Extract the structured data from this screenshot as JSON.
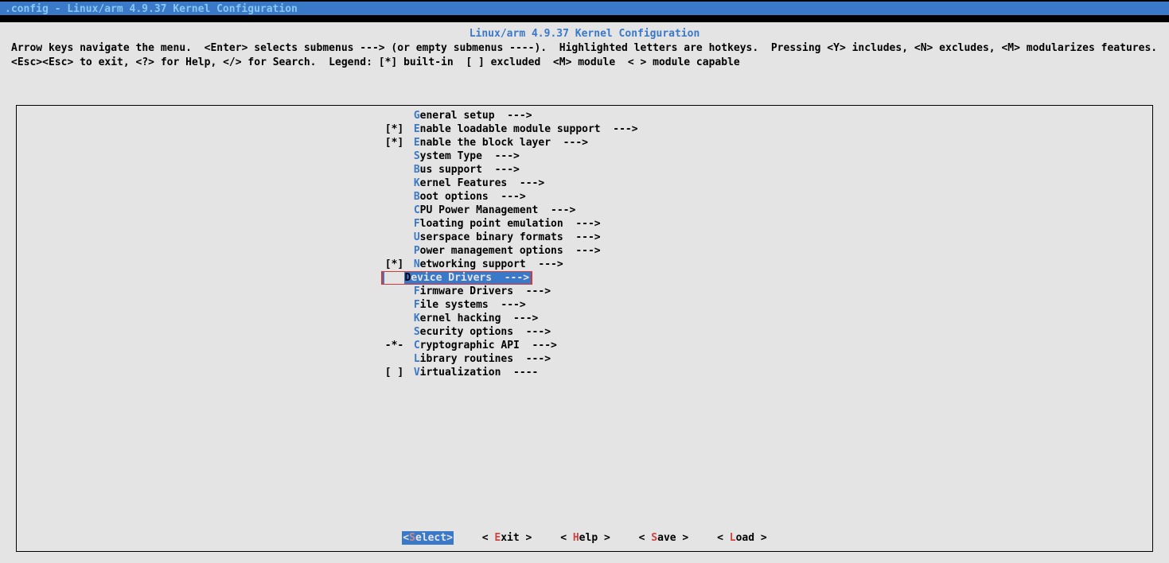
{
  "window_title": ".config - Linux/arm 4.9.37 Kernel Configuration",
  "header_title": "Linux/arm 4.9.37 Kernel Configuration",
  "instructions_line1": "Arrow keys navigate the menu.  <Enter> selects submenus ---> (or empty submenus ----).  Highlighted letters are hotkeys.  Pressing <Y> includes, <N> excludes, <M> modularizes features.  Press",
  "instructions_line2": "<Esc><Esc> to exit, <?> for Help, </> for Search.  Legend: [*] built-in  [ ] excluded  <M> module  < > module capable",
  "menu": [
    {
      "prefix": "   ",
      "hk": "G",
      "rest": "eneral setup  --->"
    },
    {
      "prefix": "[*]",
      "hk": "E",
      "rest": "nable loadable module support  --->"
    },
    {
      "prefix": "[*]",
      "hk": "E",
      "rest": "nable the block layer  --->"
    },
    {
      "prefix": "   ",
      "hk": "S",
      "rest": "ystem Type  --->"
    },
    {
      "prefix": "   ",
      "hk": "B",
      "rest": "us support  --->"
    },
    {
      "prefix": "   ",
      "hk": "K",
      "rest": "ernel Features  --->"
    },
    {
      "prefix": "   ",
      "hk": "B",
      "rest": "oot options  --->"
    },
    {
      "prefix": "   ",
      "hk": "C",
      "rest": "PU Power Management  --->"
    },
    {
      "prefix": "   ",
      "hk": "F",
      "rest": "loating point emulation  --->"
    },
    {
      "prefix": "   ",
      "hk": "U",
      "rest": "serspace binary formats  --->"
    },
    {
      "prefix": "   ",
      "hk": "P",
      "rest": "ower management options  --->"
    },
    {
      "prefix": "[*]",
      "hk": "N",
      "rest": "etworking support  --->"
    },
    {
      "prefix": "   ",
      "hk": "D",
      "rest": "evice Drivers  --->",
      "selected": true
    },
    {
      "prefix": "   ",
      "hk": "F",
      "rest": "irmware Drivers  --->"
    },
    {
      "prefix": "   ",
      "hk": "F",
      "rest": "ile systems  --->"
    },
    {
      "prefix": "   ",
      "hk": "K",
      "rest": "ernel hacking  --->"
    },
    {
      "prefix": "   ",
      "hk": "S",
      "rest": "ecurity options  --->"
    },
    {
      "prefix": "-*-",
      "hk": "C",
      "rest": "ryptographic API  --->"
    },
    {
      "prefix": "   ",
      "hk": "L",
      "rest": "ibrary routines  --->"
    },
    {
      "prefix": "[ ]",
      "hk": "V",
      "rest": "irtualization  ----"
    }
  ],
  "buttons": {
    "select": {
      "label": "Select",
      "hk": "S"
    },
    "exit": {
      "label": "Exit",
      "hk": "E"
    },
    "help": {
      "label": "Help",
      "hk": "H"
    },
    "save": {
      "label": "Save",
      "hk": "S"
    },
    "load": {
      "label": "Load",
      "hk": "L"
    }
  }
}
